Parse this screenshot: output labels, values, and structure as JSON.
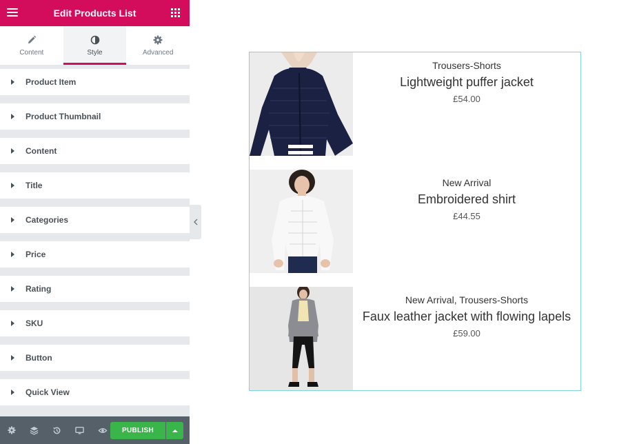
{
  "panel": {
    "title": "Edit Products List",
    "tabs": [
      {
        "label": "Content",
        "icon": "pencil-icon"
      },
      {
        "label": "Style",
        "icon": "contrast-icon"
      },
      {
        "label": "Advanced",
        "icon": "gear-icon"
      }
    ],
    "active_tab": "Style",
    "sections": [
      {
        "label": "Product Item"
      },
      {
        "label": "Product Thumbnail"
      },
      {
        "label": "Content"
      },
      {
        "label": "Title"
      },
      {
        "label": "Categories"
      },
      {
        "label": "Price"
      },
      {
        "label": "Rating"
      },
      {
        "label": "SKU"
      },
      {
        "label": "Button"
      },
      {
        "label": "Quick View"
      }
    ],
    "footer": {
      "publish_label": "PUBLISH",
      "icons": [
        "settings-icon",
        "layers-icon",
        "history-icon",
        "responsive-icon",
        "preview-eye-icon"
      ]
    }
  },
  "colors": {
    "brand": "#d30c5c",
    "publish": "#39b54a",
    "panel_bg": "#e6e9ec",
    "footer_bg": "#556068",
    "preview_border": "#7fd3e3"
  },
  "products": [
    {
      "category": "Trousers-Shorts",
      "title": "Lightweight puffer jacket",
      "price": "£54.00"
    },
    {
      "category": "New Arrival",
      "title": "Embroidered shirt",
      "price": "£44.55"
    },
    {
      "category": "New Arrival, Trousers-Shorts",
      "title": "Faux leather jacket with flowing lapels",
      "price": "£59.00"
    }
  ]
}
